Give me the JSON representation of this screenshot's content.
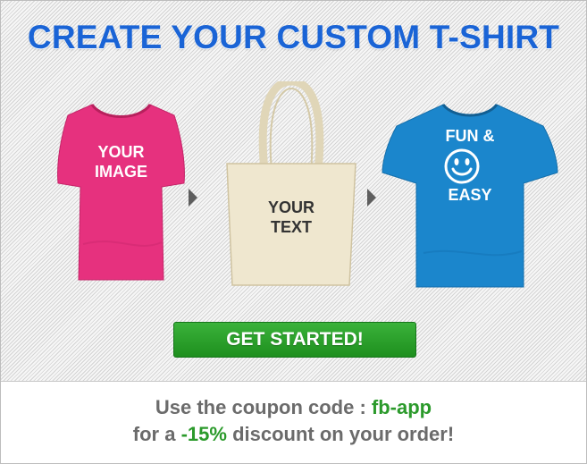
{
  "page": {
    "title": "CREATE YOUR CUSTOM T-SHIRT",
    "title_color": "#1a64d6"
  },
  "products": [
    {
      "name": "pink-tshirt",
      "color": "#e6317e",
      "text_lines": [
        "YOUR",
        "IMAGE"
      ],
      "text_color": "#ffffff"
    },
    {
      "name": "tote-bag",
      "color": "#efe7cf",
      "text_lines": [
        "YOUR",
        "TEXT"
      ],
      "text_color": "#333333"
    },
    {
      "name": "blue-tshirt",
      "color": "#1b86cc",
      "text_lines": [
        "FUN &",
        "EASY"
      ],
      "text_color": "#ffffff",
      "icon": "smiley-icon"
    }
  ],
  "cta": {
    "label": "GET STARTED!",
    "color": "#2ea22e"
  },
  "coupon": {
    "line1_prefix": "Use the coupon code : ",
    "code": "fb-app",
    "line2_prefix": "for a ",
    "discount": "-15%",
    "line2_suffix": " discount on your order!",
    "text_color": "#6b6b6b",
    "accent_color": "#2b9a2b"
  }
}
